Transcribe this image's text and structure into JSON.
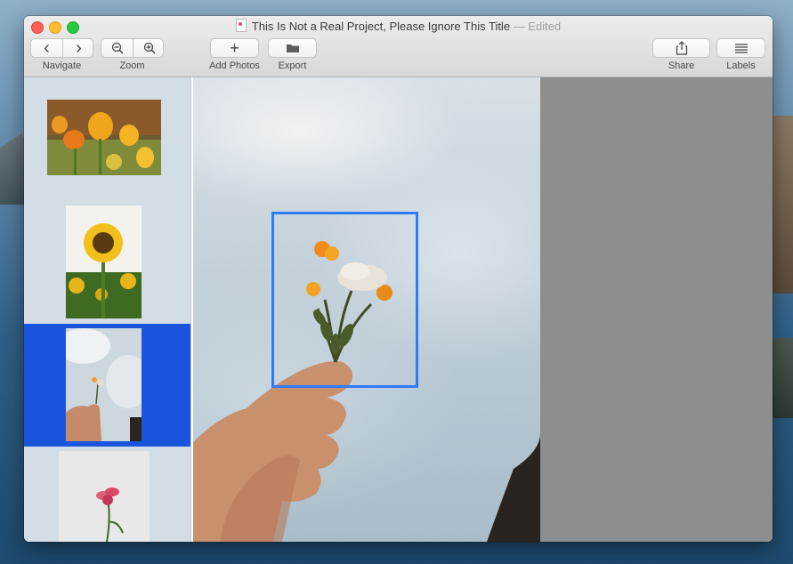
{
  "window": {
    "title": "This Is Not a Real Project, Please Ignore This Title",
    "edited_suffix": "— Edited"
  },
  "toolbar": {
    "navigate_label": "Navigate",
    "zoom_label": "Zoom",
    "add_photos_label": "Add Photos",
    "export_label": "Export",
    "share_label": "Share",
    "labels_label": "Labels",
    "back_glyph": "‹",
    "forward_glyph": "›",
    "add_glyph": "+"
  },
  "sidebar": {
    "thumbnails": [
      {
        "name": "tulips",
        "selected": false
      },
      {
        "name": "sunflower",
        "selected": false
      },
      {
        "name": "hand-with-flowers",
        "selected": true
      },
      {
        "name": "pink-flower",
        "selected": false
      }
    ]
  },
  "colors": {
    "accent": "#1c55dd",
    "crop_border": "#2f7bf5",
    "canvas_bg": "#8d8e8e"
  }
}
